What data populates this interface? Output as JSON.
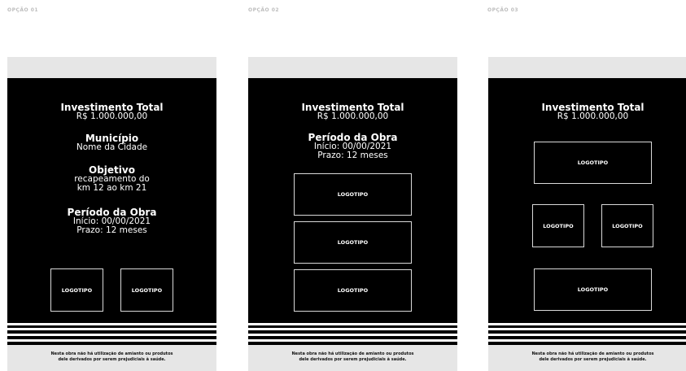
{
  "options": [
    {
      "label": "OPÇÃO 01"
    },
    {
      "label": "OPÇÃO 02"
    },
    {
      "label": "OPÇÃO 03"
    }
  ],
  "content": {
    "investimento_title": "Investimento Total",
    "investimento_value": "R$ 1.000.000,00",
    "municipio_title": "Município",
    "municipio_value": "Nome da Cidade",
    "objetivo_title": "Objetivo",
    "objetivo_line1": "recapeamento do",
    "objetivo_line2": "km 12 ao km 21",
    "periodo_title": "Período da Obra",
    "inicio": "Início: 00/00/2021",
    "prazo": "Prazo: 12 meses",
    "logo": "LOGOTIPO"
  },
  "footer": {
    "line1": "Nesta obra não há utilização de amianto ou produtos",
    "line2": "dele derivados por serem prejudiciais à saúde."
  },
  "colors": {
    "black": "#000000",
    "bar": "#e6e6e6",
    "label": "#bdbdbd"
  }
}
